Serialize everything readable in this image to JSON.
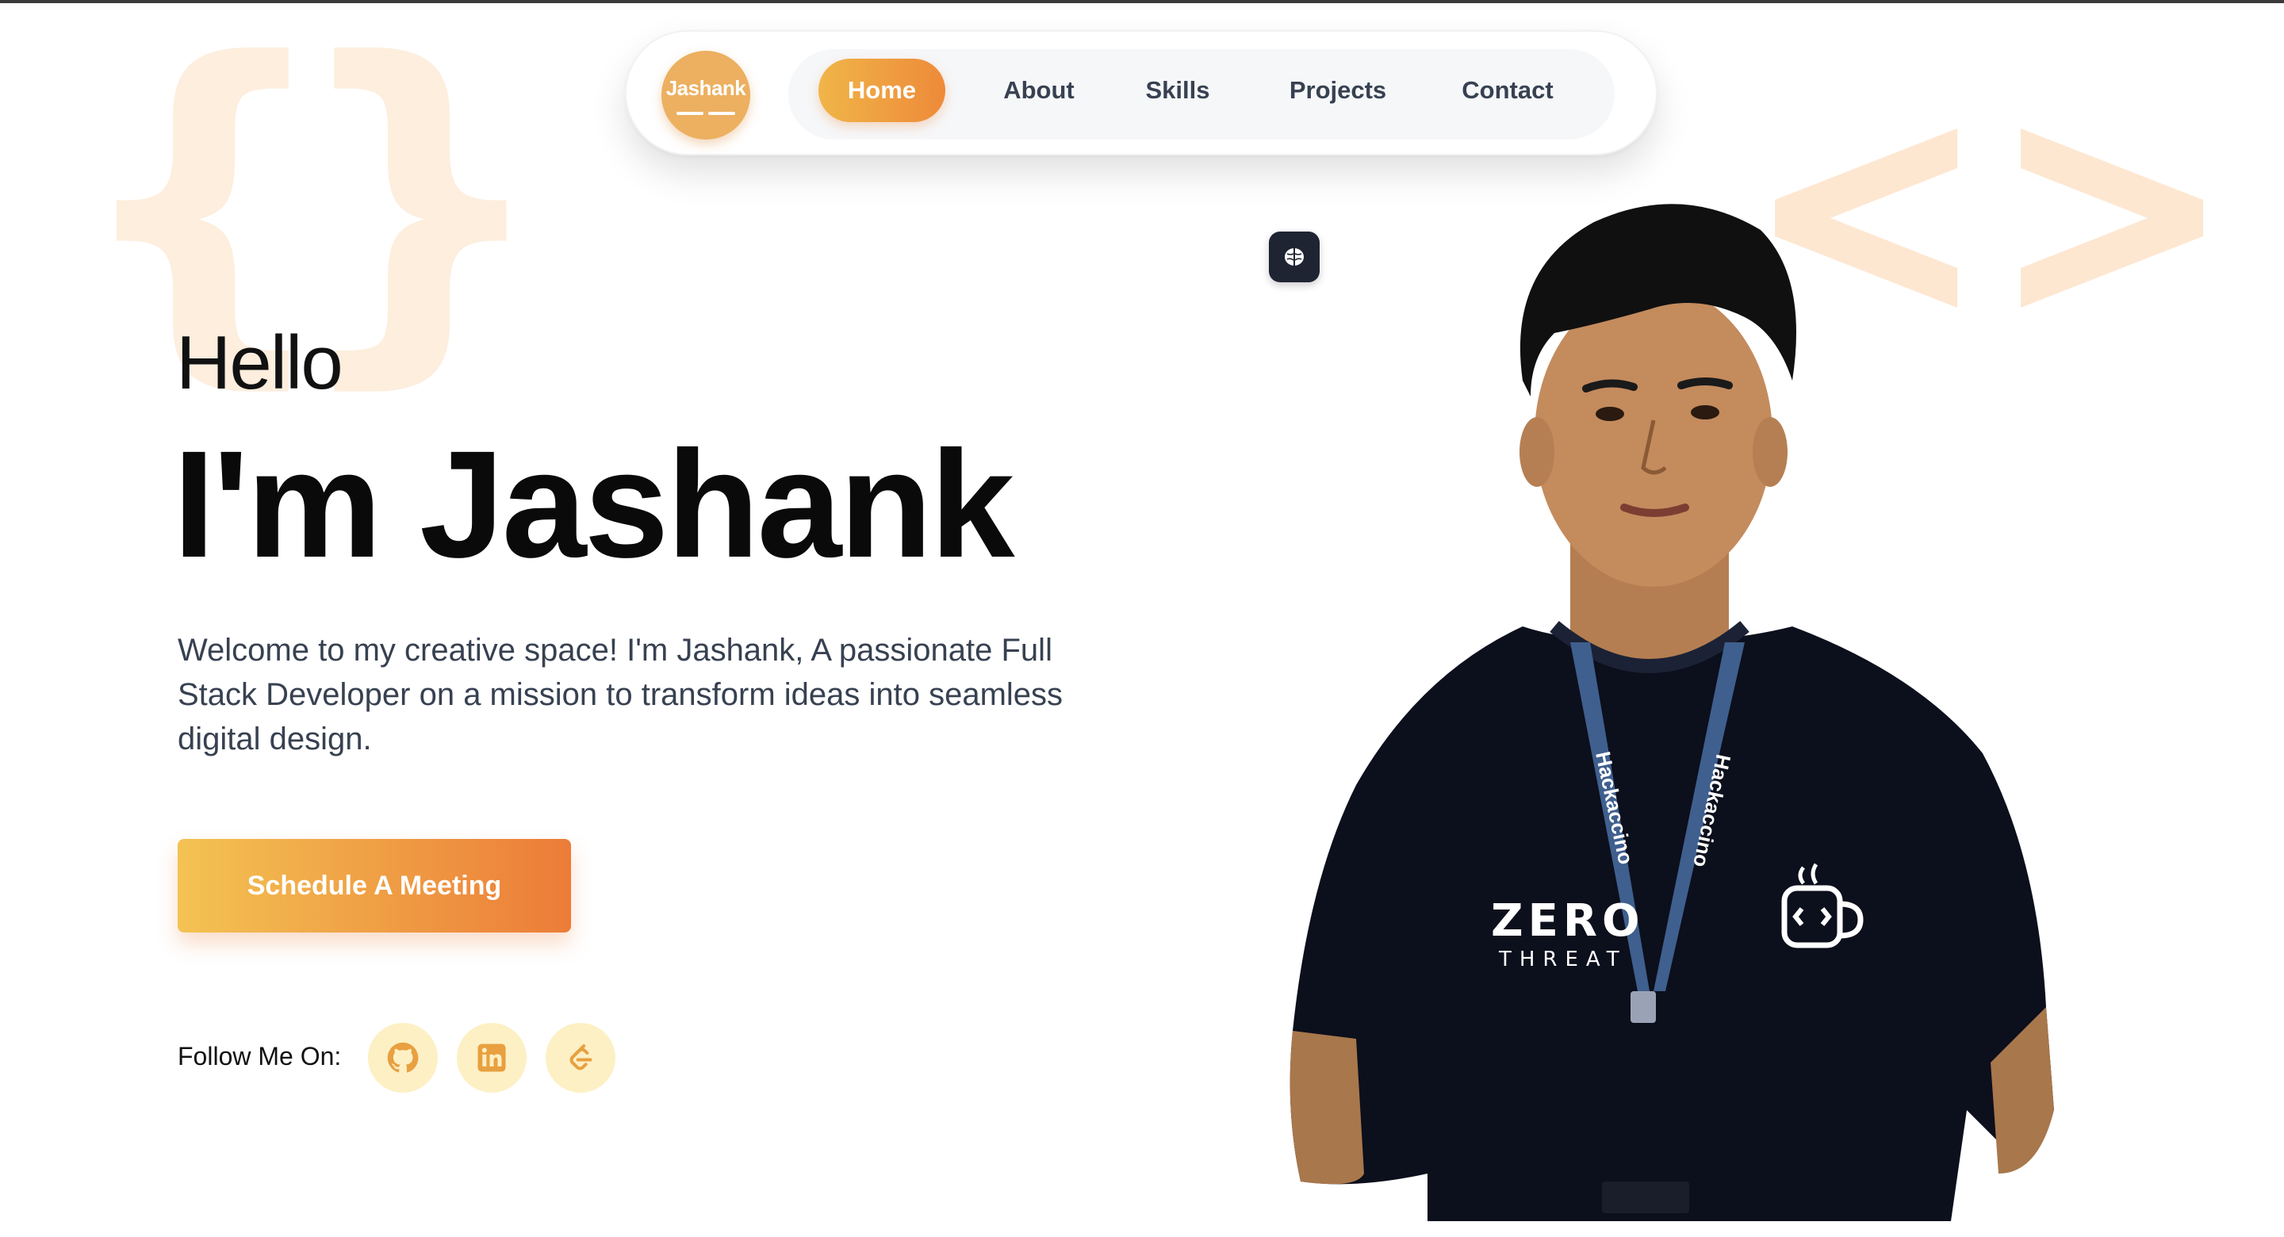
{
  "nav": {
    "logo_text": "Jashank",
    "items": [
      {
        "label": "Home",
        "active": true
      },
      {
        "label": "About",
        "active": false
      },
      {
        "label": "Skills",
        "active": false
      },
      {
        "label": "Projects",
        "active": false
      },
      {
        "label": "Contact",
        "active": false
      }
    ]
  },
  "hero": {
    "greeting": "Hello",
    "name": "I'm Jashank",
    "intro": "Welcome to my creative space! I'm Jashank, A passionate Full Stack Developer on a mission to transform ideas into seamless digital design.",
    "cta_label": "Schedule A Meeting"
  },
  "social": {
    "label": "Follow Me On:",
    "icons": [
      "github-icon",
      "linkedin-icon",
      "leetcode-icon"
    ]
  },
  "theme_toggle_icon": "brain-icon",
  "decor": {
    "left_symbol": "{}",
    "right_symbol": "<>"
  },
  "portrait": {
    "shirt_text_line1": "ZERO",
    "shirt_text_line2": "THREAT",
    "lanyard_text": "Hackaccino"
  },
  "colors": {
    "accent_start": "#f3c352",
    "accent_end": "#ec7c38",
    "logo_bg": "#ecb060",
    "social_bg": "#fdf0c4",
    "social_icon": "#e8a040",
    "deco": "#fdecd9",
    "text_dark": "#0a0a0a",
    "text_body": "#374151"
  }
}
